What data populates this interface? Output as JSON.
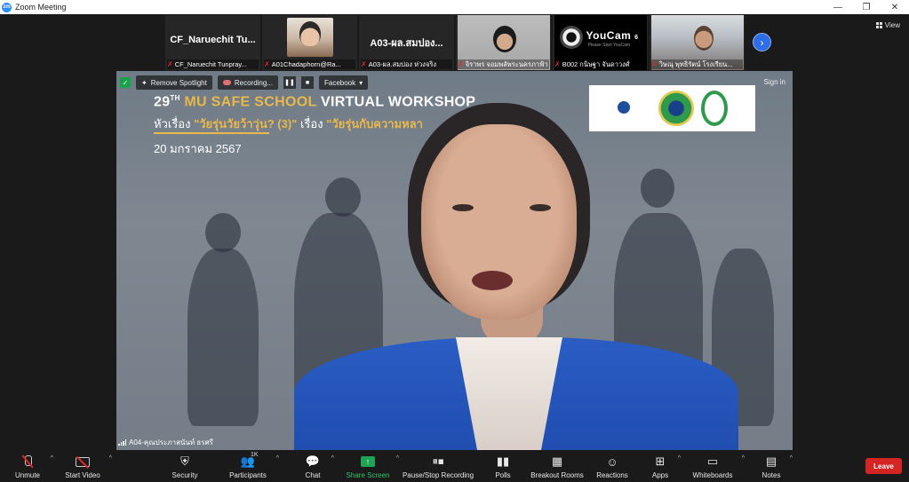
{
  "window": {
    "title": "Zoom Meeting",
    "app_icon": "zm",
    "minimize": "—",
    "maximize": "❐",
    "close": "✕"
  },
  "view_button": {
    "label": "View",
    "icon": "grid-icon"
  },
  "participants_strip": [
    {
      "big_name": "CF_Naruechit  Tu...",
      "label": "CF_Naruechit Tunpray...",
      "muted": true,
      "video": false
    },
    {
      "big_name": "",
      "label": "A01Chadaphorn@Ra...",
      "muted": true,
      "video": true
    },
    {
      "big_name": "A03-ผล.สมปอง...",
      "label": "A03-ผล.สมปอง ห่วงจริง",
      "muted": true,
      "video": false
    },
    {
      "big_name": "",
      "label": "จิราพร จอมพลัพระนครภาฟ้า",
      "muted": true,
      "video": true
    },
    {
      "big_name": "",
      "label": "B002 กนิษฐา จันดาวงศ์",
      "muted": true,
      "video": true,
      "youcam": "YouCam",
      "youcam_ver": "6",
      "youcam_sub": "Please Start YouCam"
    },
    {
      "big_name": "",
      "label": "วิษณุ  พุทธิรัตน์ โรงเรียน...",
      "muted": true,
      "video": true
    }
  ],
  "next_page_icon": "›",
  "spotlight": {
    "remove_spotlight": "Remove Spotlight",
    "recording": "Recording...",
    "pause_icon": "❚❚",
    "stop_icon": "■",
    "facebook": "Facebook",
    "sign_in": "Sign in"
  },
  "slide": {
    "th_number": "29",
    "th_sup": "TH",
    "mu": "MU SAFE SCHOOL",
    "workshop": "VIRTUAL WORKSHOP",
    "topic_prefix": "หัวเรื่อง",
    "topic_highlight": "\"วัยรุ่นวัยว้าวุ่น? (3)\"",
    "subtopic_prefix": "เรื่อง",
    "subtopic_highlight": "\"วัยรุ่นกับความหลา",
    "date": "20 มกราคม 2567"
  },
  "speaker": {
    "name": "A04-คุณประภาสนันท์ ธรศรี"
  },
  "bottom_controls": {
    "unmute": "Unmute",
    "start_video": "Start Video",
    "security": "Security",
    "participants": "Participants",
    "participants_count": "1K",
    "chat": "Chat",
    "share_screen": "Share Screen",
    "pause_stop_recording": "Pause/Stop Recording",
    "polls": "Polls",
    "breakout_rooms": "Breakout Rooms",
    "reactions": "Reactions",
    "apps": "Apps",
    "whiteboards": "Whiteboards",
    "notes": "Notes",
    "leave": "Leave"
  },
  "colors": {
    "accent": "#2d8cff",
    "leave": "#d42424",
    "share": "#1fa355",
    "mute": "#e02828",
    "slide_highlight": "#e8b84c"
  }
}
